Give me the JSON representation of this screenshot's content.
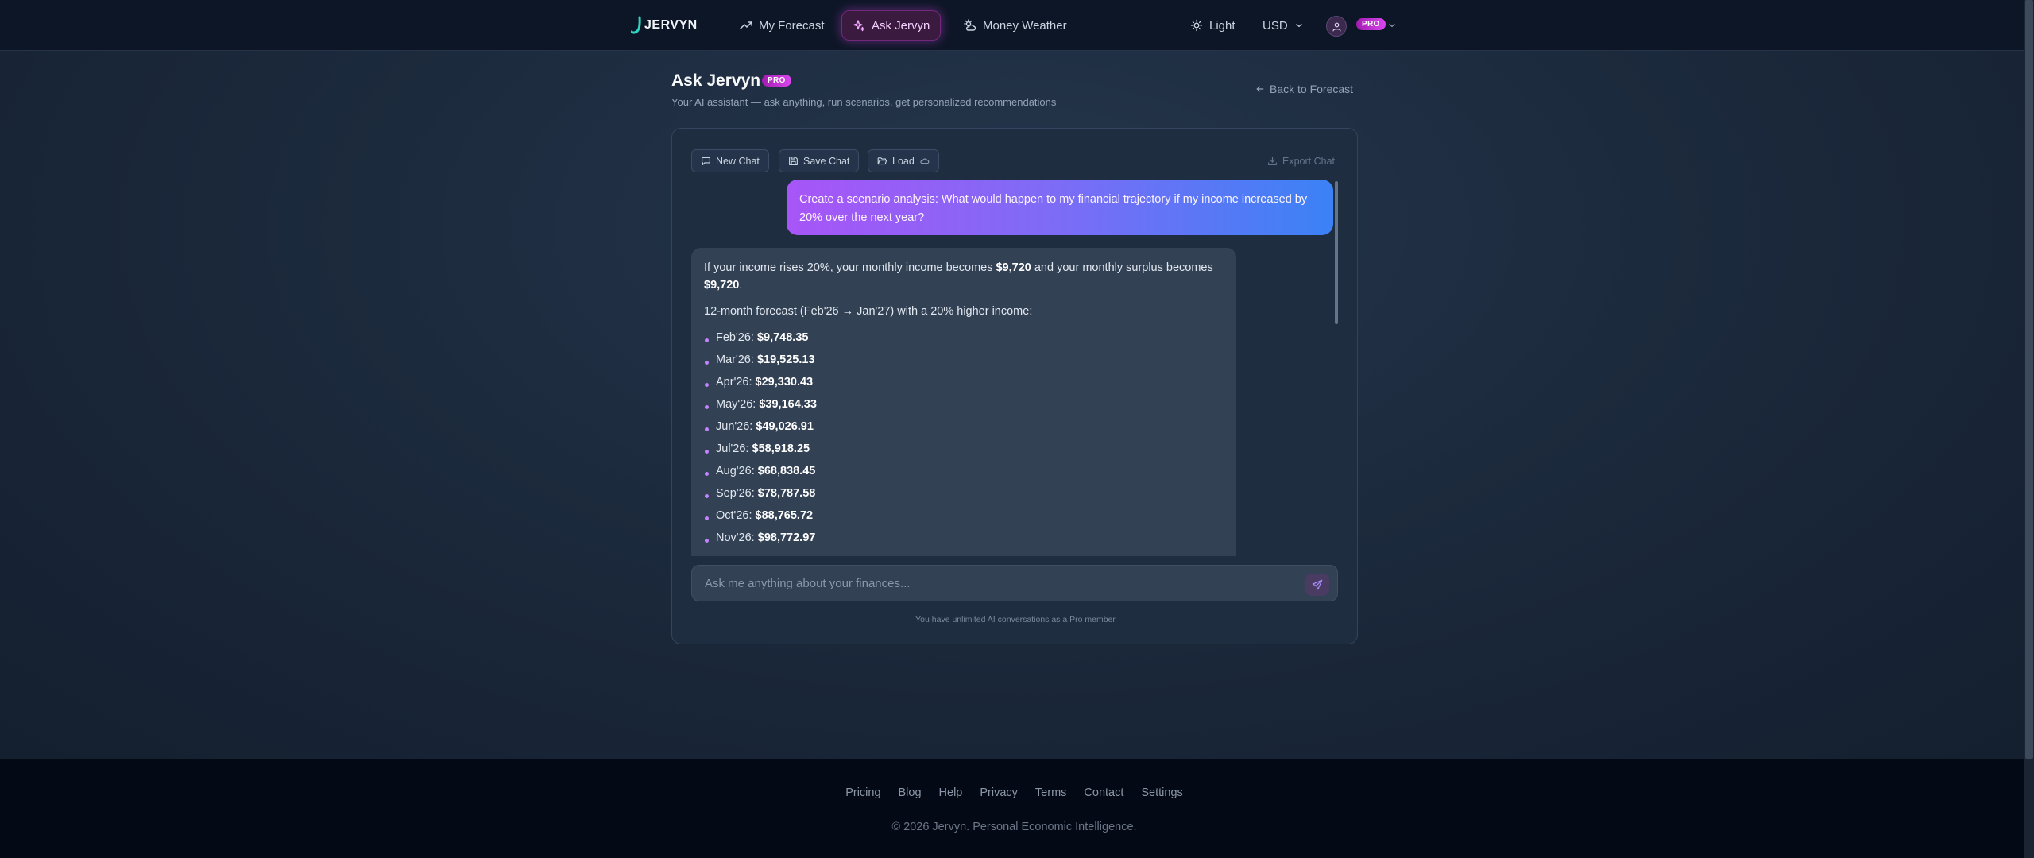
{
  "nav": {
    "logo_text": "JERVYN",
    "forecast_label": "My Forecast",
    "ask_label": "Ask Jervyn",
    "weather_label": "Money Weather",
    "theme_label": "Light",
    "currency_label": "USD",
    "pro_badge": "PRO"
  },
  "header": {
    "title": "Ask Jervyn",
    "pro_badge": "PRO",
    "subtitle": "Your AI assistant — ask anything, run scenarios, get personalized recommendations",
    "back_link": "Back to Forecast"
  },
  "toolbar": {
    "new_chat": "New Chat",
    "save_chat": "Save Chat",
    "load": "Load",
    "export_chat": "Export Chat"
  },
  "chat": {
    "user_message": "Create a scenario analysis: What would happen to my financial trajectory if my income increased by 20% over the next year?",
    "assistant": {
      "p1_a": "If your income rises 20%, your monthly income becomes ",
      "p1_b": "$9,720",
      "p1_c": " and your monthly surplus becomes ",
      "p1_d": "$9,720",
      "p1_e": ".",
      "p2": "12-month forecast (Feb'26 → Jan'27) with a 20% higher income:",
      "forecast": [
        {
          "month": "Feb'26:",
          "value": "$9,748.35"
        },
        {
          "month": "Mar'26:",
          "value": "$19,525.13"
        },
        {
          "month": "Apr'26:",
          "value": "$29,330.43"
        },
        {
          "month": "May'26:",
          "value": "$39,164.33"
        },
        {
          "month": "Jun'26:",
          "value": "$49,026.91"
        },
        {
          "month": "Jul'26:",
          "value": "$58,918.25"
        },
        {
          "month": "Aug'26:",
          "value": "$68,838.45"
        },
        {
          "month": "Sep'26:",
          "value": "$78,787.58"
        },
        {
          "month": "Oct'26:",
          "value": "$88,765.72"
        },
        {
          "month": "Nov'26:",
          "value": "$98,772.97"
        }
      ]
    }
  },
  "input": {
    "placeholder": "Ask me anything about your finances...",
    "note": "You have unlimited AI conversations as a Pro member"
  },
  "footer": {
    "links": [
      "Pricing",
      "Blog",
      "Help",
      "Privacy",
      "Terms",
      "Contact",
      "Settings"
    ],
    "copyright": "© 2026 Jervyn. Personal Economic Intelligence."
  },
  "colors": {
    "accent": "#d946ef",
    "user_bubble_start": "#a855f7",
    "user_bubble_end": "#3b82f6",
    "background": "#1c2a3d",
    "footer": "#040a15"
  }
}
